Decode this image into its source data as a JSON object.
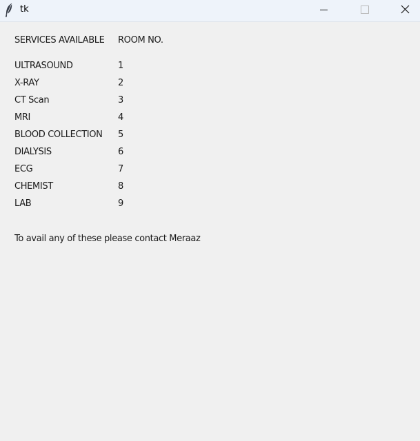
{
  "window": {
    "title": "tk"
  },
  "header": {
    "services_label": "SERVICES AVAILABLE",
    "room_label": "ROOM NO."
  },
  "services": [
    {
      "name": "ULTRASOUND",
      "room": "1"
    },
    {
      "name": "X-RAY",
      "room": "2"
    },
    {
      "name": "CT Scan",
      "room": "3"
    },
    {
      "name": "MRI",
      "room": "4"
    },
    {
      "name": "BLOOD COLLECTION",
      "room": "5"
    },
    {
      "name": "DIALYSIS",
      "room": "6"
    },
    {
      "name": "ECG",
      "room": "7"
    },
    {
      "name": "CHEMIST",
      "room": "8"
    },
    {
      "name": "LAB",
      "room": "9"
    }
  ],
  "footer": {
    "note": "To avail any of these please contact Meraaz"
  },
  "colors": {
    "background": "#f0f0f0",
    "titlebar": "#eef3fa",
    "text": "#1a1a1a"
  },
  "icons": {
    "app": "feather-icon",
    "minimize": "minimize-icon",
    "maximize": "maximize-icon",
    "close": "close-icon"
  }
}
